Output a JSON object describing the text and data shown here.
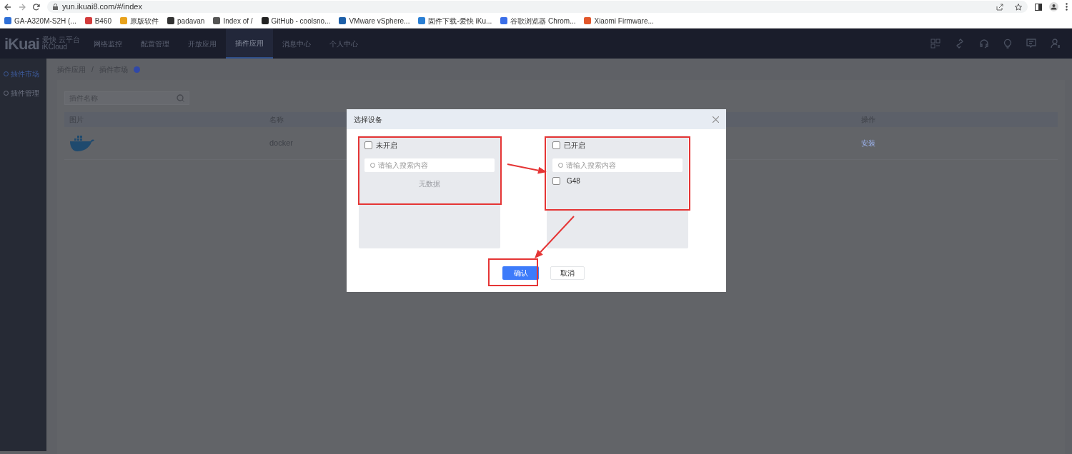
{
  "browser": {
    "url": "yun.ikuai8.com/#/index",
    "bookmarks": [
      {
        "label": "GA-A320M-S2H (...",
        "color": "#2f6fd6"
      },
      {
        "label": "B460",
        "color": "#d33b3b"
      },
      {
        "label": "原版软件",
        "color": "#e8a21c"
      },
      {
        "label": "padavan",
        "color": "#333333"
      },
      {
        "label": "Index of /",
        "color": "#555555"
      },
      {
        "label": "GitHub - coolsno...",
        "color": "#222222"
      },
      {
        "label": "VMware vSphere...",
        "color": "#1d5fa8"
      },
      {
        "label": "固件下载-爱快 iKu...",
        "color": "#2a7fd4"
      },
      {
        "label": "谷歌浏览器 Chrom...",
        "color": "#3a6ee8"
      },
      {
        "label": "Xiaomi Firmware...",
        "color": "#e2572b"
      }
    ]
  },
  "app": {
    "logo": "iKuai",
    "logo_cn": "爱快 云平台",
    "logo_en": "iKCloud",
    "nav": [
      {
        "label": "网络监控",
        "selected": false
      },
      {
        "label": "配置管理",
        "selected": false
      },
      {
        "label": "开放应用",
        "selected": false
      },
      {
        "label": "插件应用",
        "selected": true
      },
      {
        "label": "消息中心",
        "selected": false
      },
      {
        "label": "个人中心",
        "selected": false
      }
    ],
    "sidebar": [
      {
        "label": "插件市场",
        "selected": true
      },
      {
        "label": "插件管理",
        "selected": false
      }
    ],
    "breadcrumb": [
      "插件应用",
      "插件市场"
    ],
    "separator": "/",
    "search": {
      "placeholder": "插件名称"
    },
    "table": {
      "columns": [
        "图片",
        "名称",
        "操作"
      ],
      "rows": [
        {
          "name": "docker",
          "action": "安装"
        }
      ]
    }
  },
  "dialog": {
    "title": "选择设备",
    "panels": [
      {
        "title": "未开启",
        "checked": false,
        "search_placeholder": "请输入搜索内容",
        "empty_text": "无数据"
      },
      {
        "title": "已开启",
        "checked": false,
        "search_placeholder": "请输入搜索内容",
        "items": [
          {
            "label": "G48",
            "checked": false
          }
        ]
      }
    ],
    "buttons": [
      {
        "label": "确认",
        "kind": "primary"
      },
      {
        "label": "取消",
        "kind": "secondary"
      }
    ]
  },
  "annotations": [
    {
      "kind": "box"
    },
    {
      "kind": "box"
    },
    {
      "kind": "box"
    },
    {
      "kind": "arrow"
    },
    {
      "kind": "arrow"
    }
  ]
}
